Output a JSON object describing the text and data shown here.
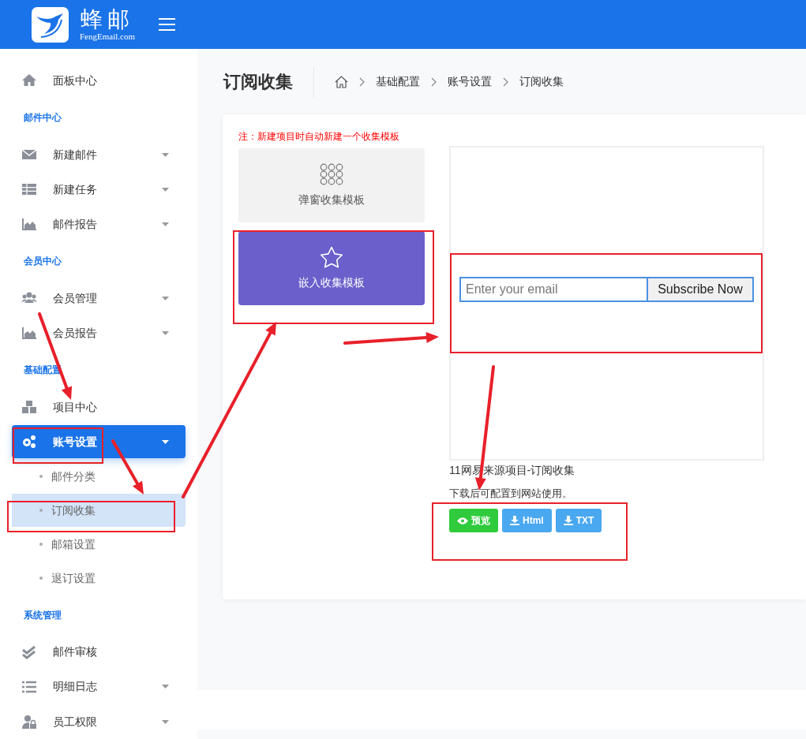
{
  "header": {
    "brand_name": "蜂邮",
    "brand_domain": "FengEmail.com"
  },
  "sidebar": {
    "items": [
      {
        "kind": "item",
        "label": "面板中心",
        "has_caret": false,
        "selected": false
      },
      {
        "kind": "section",
        "label": "邮件中心"
      },
      {
        "kind": "item",
        "label": "新建邮件",
        "has_caret": true,
        "selected": false
      },
      {
        "kind": "item",
        "label": "新建任务",
        "has_caret": true,
        "selected": false
      },
      {
        "kind": "item",
        "label": "邮件报告",
        "has_caret": true,
        "selected": false
      },
      {
        "kind": "section",
        "label": "会员中心"
      },
      {
        "kind": "item",
        "label": "会员管理",
        "has_caret": true,
        "selected": false
      },
      {
        "kind": "item",
        "label": "会员报告",
        "has_caret": true,
        "selected": false
      },
      {
        "kind": "section",
        "label": "基础配置"
      },
      {
        "kind": "item",
        "label": "项目中心",
        "has_caret": false,
        "selected": false
      },
      {
        "kind": "item",
        "label": "账号设置",
        "has_caret": true,
        "selected": true,
        "expanded": true,
        "children": [
          {
            "label": "邮件分类",
            "selected": false
          },
          {
            "label": "订阅收集",
            "selected": true
          },
          {
            "label": "邮箱设置",
            "selected": false
          },
          {
            "label": "退订设置",
            "selected": false
          }
        ]
      },
      {
        "kind": "section",
        "label": "系统管理"
      },
      {
        "kind": "item",
        "label": "邮件审核",
        "has_caret": false,
        "selected": false
      },
      {
        "kind": "item",
        "label": "明细日志",
        "has_caret": true,
        "selected": false
      },
      {
        "kind": "item",
        "label": "员工权限",
        "has_caret": true,
        "selected": false
      }
    ]
  },
  "page": {
    "title": "订阅收集",
    "breadcrumb": [
      "基础配置",
      "账号设置",
      "订阅收集"
    ]
  },
  "card": {
    "note": "注：新建项目时自动新建一个收集模板",
    "templates": [
      {
        "label": "弹窗收集模板",
        "selected": false
      },
      {
        "label": "嵌入收集模板",
        "selected": true
      }
    ],
    "preview": {
      "email_placeholder": "Enter your email",
      "button_label": "Subscribe Now"
    },
    "caption": "11网易来源项目-订阅收集",
    "hint": "下载后可配置到网站使用。",
    "buttons": [
      {
        "kind": "preview",
        "label": "预览"
      },
      {
        "kind": "download",
        "label": "Html"
      },
      {
        "kind": "download",
        "label": "TXT"
      }
    ]
  }
}
